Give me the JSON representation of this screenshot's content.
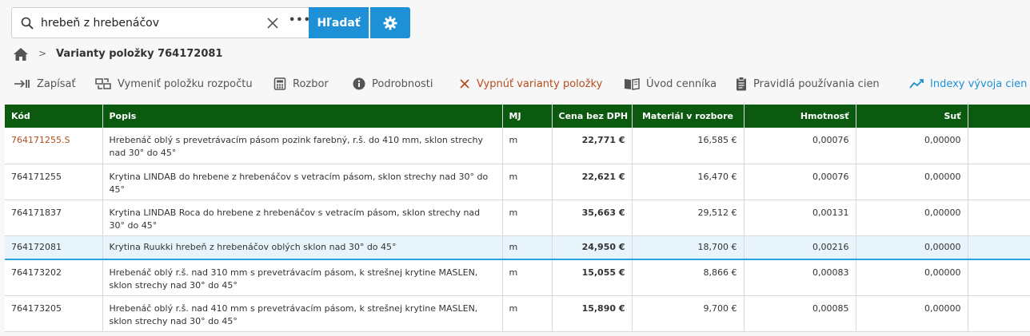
{
  "search": {
    "value": "hrebeň z hrebenáčov",
    "more_label": "•••",
    "button_label": "Hľadať"
  },
  "breadcrumb": {
    "separator": ">",
    "title": "Varianty položky 764172081"
  },
  "toolbar": {
    "write": "Zapísať",
    "replace": "Vymeniť položku rozpočtu",
    "analysis": "Rozbor",
    "details": "Podrobnosti",
    "disable": "Vypnúť varianty položky",
    "intro": "Úvod cenníka",
    "rules": "Pravidlá používania cien",
    "indexes": "Indexy vývoja cien"
  },
  "table": {
    "headers": [
      "Kód",
      "Popis",
      "MJ",
      "Cena bez DPH",
      "Materiál v rozbore",
      "Hmotnosť",
      "Suť"
    ],
    "rows": [
      {
        "code": "764171255.S",
        "desc": "Hrebenáč oblý s prevetrávacím pásom pozink farebný, r.š. do 410 mm, sklon strechy nad 30° do 45°",
        "mj": "m",
        "price": "22,771 €",
        "material": "16,585 €",
        "weight": "0,00076",
        "sut": "0,00000"
      },
      {
        "code": "764171255",
        "desc": "Krytina LINDAB do hrebene z hrebenáčov s vetracím pásom, sklon strechy nad 30° do 45°",
        "mj": "m",
        "price": "22,621 €",
        "material": "16,470 €",
        "weight": "0,00076",
        "sut": "0,00000"
      },
      {
        "code": "764171837",
        "desc": "Krytina LINDAB Roca do hrebene z hrebenáčov s vetracím pásom, sklon strechy nad 30° do 45°",
        "mj": "m",
        "price": "35,663 €",
        "material": "29,512 €",
        "weight": "0,00131",
        "sut": "0,00000"
      },
      {
        "code": "764172081",
        "desc": "Krytina Ruukki hrebeň z hrebenáčov oblých sklon nad 30° do 45°",
        "mj": "m",
        "price": "24,950 €",
        "material": "18,700 €",
        "weight": "0,00216",
        "sut": "0,00000"
      },
      {
        "code": "764173202",
        "desc": "Hrebenáč oblý r.š. nad 310 mm s prevetrávacím pásom, k strešnej krytine MASLEN, sklon strechy nad 30° do 45°",
        "mj": "m",
        "price": "15,055 €",
        "material": "8,866 €",
        "weight": "0,00083",
        "sut": "0,00000"
      },
      {
        "code": "764173205",
        "desc": "Hrebenáč oblý r.š. nad 410 mm s prevetrávacím pásom, k strešnej krytine MASLEN, sklon strechy nad 30° do 45°",
        "mj": "m",
        "price": "15,890 €",
        "material": "9,700 €",
        "weight": "0,00085",
        "sut": "0,00000"
      }
    ]
  },
  "icons": {
    "search": "search-icon",
    "clear": "close-icon",
    "settings": "gear-icon",
    "home": "home-icon"
  },
  "colors": {
    "accent": "#1e90d6",
    "header": "#0c5a10",
    "link": "#b54c1c",
    "selected": "#e8f4fb"
  }
}
